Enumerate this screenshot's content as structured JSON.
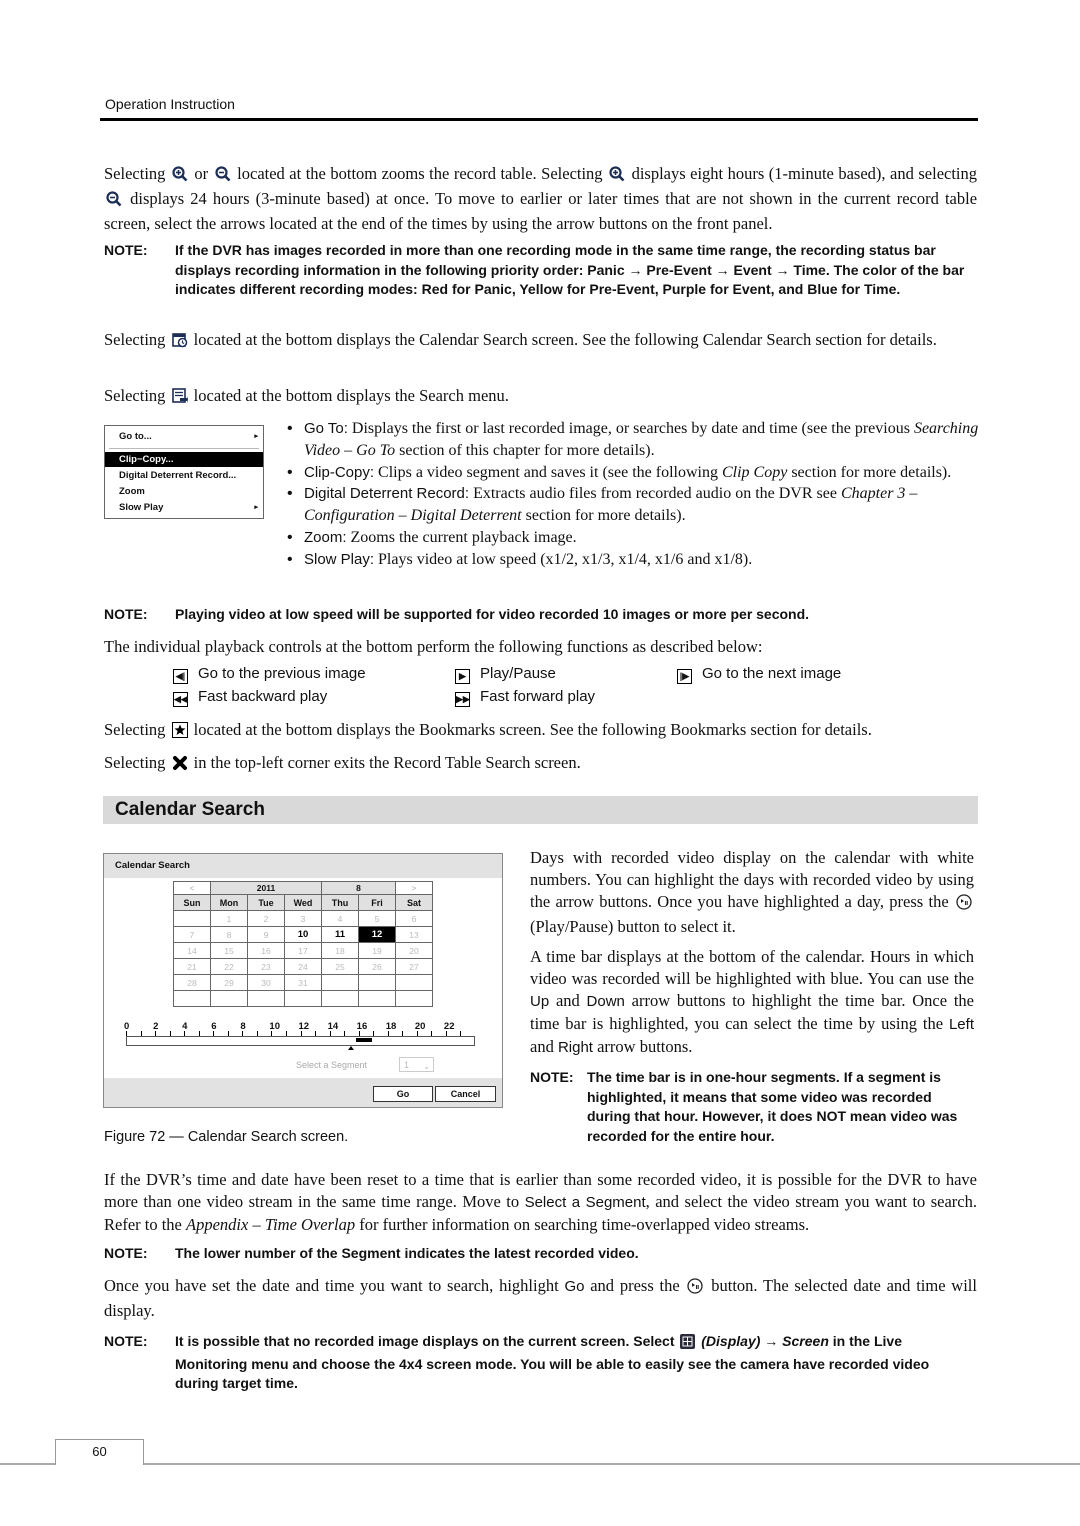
{
  "header": {
    "section_label": "Operation Instruction"
  },
  "intro": {
    "zoom_para": {
      "t1": "Selecting",
      "t2": "or",
      "t3": "located at the bottom zooms the record table.  Selecting",
      "t4": "displays eight hours (1-minute based), and selecting",
      "t5": "displays 24 hours (3-minute based) at once.  To move to earlier or later times that are not shown in the current record table screen, select the arrows located at the end of the times by using the arrow buttons on the front panel."
    },
    "note1": {
      "label": "NOTE:",
      "text": "If the DVR has images recorded in more than one recording mode in the same time range, the recording status bar displays recording information in the following priority order: Panic → Pre-Event → Event → Time.  The color of the bar indicates different recording modes: Red for Panic, Yellow for Pre-Event, Purple for Event, and Blue for Time."
    },
    "calendar_para": {
      "t1": "Selecting",
      "t2": "located at the bottom displays the Calendar Search screen.  See the following Calendar Search section for details."
    },
    "search_para": {
      "t1": "Selecting",
      "t2": "located at the bottom displays the Search menu."
    }
  },
  "search_menu": {
    "items": [
      {
        "label": "Go to...",
        "has_submenu": true,
        "selected": false
      },
      {
        "label": "Clip−Copy...",
        "has_submenu": false,
        "selected": true
      },
      {
        "label": "Digital Deterrent Record...",
        "has_submenu": false,
        "selected": false
      },
      {
        "label": "Zoom",
        "has_submenu": false,
        "selected": false
      },
      {
        "label": "Slow Play",
        "has_submenu": true,
        "selected": false
      }
    ],
    "submenu_arrow": "▸"
  },
  "bullets": [
    {
      "term": "Go To:",
      "text1": " Displays the first or last recorded image, or searches by date and time (see the previous ",
      "ital": "Searching Video – Go To",
      "text2": " section of this chapter for more details)."
    },
    {
      "term": "Clip-Copy:",
      "text1": "  Clips a video segment and saves it (see the following ",
      "ital": "Clip Copy",
      "text2": " section for more details)."
    },
    {
      "term": "Digital Deterrent Record:",
      "text1": "  Extracts audio files from recorded audio on the DVR see ",
      "ital": "Chapter 3 – Configuration – Digital Deterrent",
      "text2": " section for more details)."
    },
    {
      "term": "Zoom:",
      "text1": "  Zooms the current playback image.",
      "ital": "",
      "text2": ""
    },
    {
      "term": "Slow Play:",
      "text1": "  Plays video at low speed (x1/2, x1/3, x1/4, x1/6 and x1/8).",
      "ital": "",
      "text2": ""
    }
  ],
  "note2": {
    "label": "NOTE:",
    "text": "Playing video at low speed will be supported for video recorded 10 images or more per second."
  },
  "controls_intro": "The individual playback controls at the bottom perform the following functions as described below:",
  "controls": [
    {
      "icon": "◂|",
      "glyph": "◀",
      "label": "Go to the previous image"
    },
    {
      "icon": "play",
      "glyph": "▶",
      "label": "Play/Pause"
    },
    {
      "icon": "|▸",
      "glyph": "▶",
      "label": "Go to the next image"
    },
    {
      "icon": "rewind",
      "glyph": "◀◀",
      "label": "Fast backward play"
    },
    {
      "icon": "ffwd",
      "glyph": "▶▶",
      "label": "Fast forward play"
    }
  ],
  "bookmark_para": {
    "t1": "Selecting",
    "t2": "located at the bottom displays the Bookmarks screen.  See the following Bookmarks section for details."
  },
  "exit_para": {
    "t1": "Selecting",
    "t2": "in the top-left corner exits the Record Table Search screen."
  },
  "section_title": "Calendar Search",
  "calendar_dialog": {
    "title": "Calendar Search",
    "prev": "<",
    "next": ">",
    "year": "2011",
    "month": "8",
    "weekdays": [
      "Sun",
      "Mon",
      "Tue",
      "Wed",
      "Thu",
      "Fri",
      "Sat"
    ],
    "weeks": [
      [
        "",
        "1",
        "2",
        "3",
        "4",
        "5",
        "6"
      ],
      [
        "7",
        "8",
        "9",
        "10",
        "11",
        "12",
        "13"
      ],
      [
        "14",
        "15",
        "16",
        "17",
        "18",
        "19",
        "20"
      ],
      [
        "21",
        "22",
        "23",
        "24",
        "25",
        "26",
        "27"
      ],
      [
        "28",
        "29",
        "30",
        "31",
        "",
        "",
        ""
      ],
      [
        "",
        "",
        "",
        "",
        "",
        "",
        ""
      ]
    ],
    "recorded_days": [
      "10",
      "11",
      "12"
    ],
    "selected_day": "12",
    "timeline_labels": [
      "0",
      "2",
      "4",
      "6",
      "8",
      "10",
      "12",
      "14",
      "16",
      "18",
      "20",
      "22"
    ],
    "timeline_hours": 24,
    "recorded_hours": [
      16
    ],
    "cursor_hour": 15.5,
    "segment_label": "Select a Segment",
    "segment_value": "1",
    "go_label": "Go",
    "cancel_label": "Cancel"
  },
  "figure_caption": "Figure 72 — Calendar Search screen.",
  "right_col": {
    "p1a": "Days with recorded video display on the calendar with white numbers.  You can highlight the days with recorded video by using the arrow buttons.  Once you have highlighted a day, press the",
    "p1b": " (Play/Pause) button to select it.",
    "p2a": "A time bar displays at the bottom of the calendar.  Hours in which video was recorded will be highlighted with blue.  You can use the ",
    "up": "Up",
    "and": " and ",
    "down": "Down",
    "p2b": " arrow buttons to highlight the time bar.  Once the time bar is highlighted, you can select the time by using the ",
    "left": "Left",
    "right": "Right",
    "p2c": " arrow buttons.",
    "note_label": "NOTE:",
    "note_text": "The time bar is in one-hour segments.  If a segment is highlighted, it means that some video was recorded during that hour.  However, it does NOT mean video was recorded for the entire hour."
  },
  "overlap_para": {
    "t1": "If the DVR’s time and date have been reset to a time that is earlier than some recorded video, it is possible for the DVR to have more than one video stream in the same time range.  Move to ",
    "ss": "Select a Segment",
    "t2": ", and select the video stream you want to search.  Refer to the ",
    "ital": "Appendix – Time Overlap",
    "t3": " for further information on searching time-overlapped video streams."
  },
  "note3": {
    "label": "NOTE:",
    "text": "The lower number of the Segment indicates the latest recorded video."
  },
  "go_para": {
    "t1": "Once you have set the date and time you want to search, highlight ",
    "go": "Go",
    "t2": " and press the ",
    "t3": " button.  The selected date and time will display."
  },
  "note4": {
    "label": "NOTE:",
    "t1": "It is possible that no recorded image displays on the current screen.  Select ",
    "display": "(Display)",
    "arrow": " → ",
    "screen": "Screen",
    "t2": " in the Live Monitoring menu and choose the 4x4 screen mode.  You will be able to easily see the camera have recorded video during target time."
  },
  "page_number": "60"
}
